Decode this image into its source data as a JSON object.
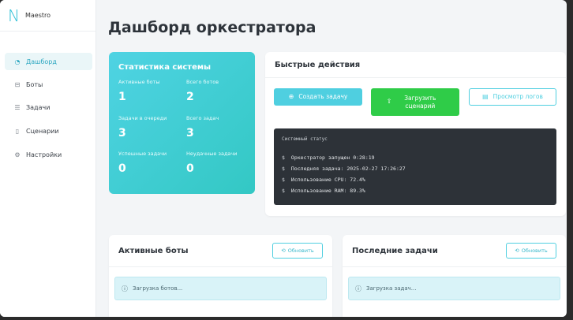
{
  "brand": {
    "logo": "N",
    "name": "Maestro"
  },
  "sidebar": {
    "items": [
      {
        "label": "Дашборд",
        "icon": "dashboard-icon",
        "glyph": "◔",
        "active": true
      },
      {
        "label": "Боты",
        "icon": "robot-icon",
        "glyph": "⊟"
      },
      {
        "label": "Задачи",
        "icon": "list-icon",
        "glyph": "☰"
      },
      {
        "label": "Сценарии",
        "icon": "file-icon",
        "glyph": "▯"
      },
      {
        "label": "Настройки",
        "icon": "gear-icon",
        "glyph": "⚙"
      }
    ]
  },
  "page": {
    "title": "Дашборд оркестратора"
  },
  "stats": {
    "title": "Статистика системы",
    "active_bots": {
      "label": "Активные боты",
      "value": "1"
    },
    "total_bots": {
      "label": "Всего ботов",
      "value": "2"
    },
    "queued_tasks": {
      "label": "Задачи в очереди",
      "value": "3"
    },
    "total_tasks": {
      "label": "Всего задач",
      "value": "3"
    },
    "success_tasks": {
      "label": "Успешные задачи",
      "value": "0"
    },
    "failed_tasks": {
      "label": "Неудачные задачи",
      "value": "0"
    }
  },
  "quick": {
    "title": "Быстрые действия",
    "create_label": "Создать задачу",
    "upload_label": "Загрузить сценарий",
    "logs_label": "Просмотр логов"
  },
  "terminal": {
    "title": "Системный статус",
    "prompt": "$",
    "lines": [
      "Оркестратор запущен 0:28:19",
      "Последняя задача: 2025-02-27 17:26:27",
      "Использование CPU: 72.4%",
      "Использование RAM: 89.3%"
    ]
  },
  "bots_panel": {
    "title": "Активные боты",
    "refresh_label": "Обновить",
    "loading": "Загрузка ботов..."
  },
  "tasks_panel": {
    "title": "Последние задачи",
    "refresh_label": "Обновить",
    "loading": "Загрузка задач..."
  },
  "colors": {
    "accent": "#4fcfe0",
    "success": "#2fcc48",
    "terminal_bg": "#2d3238"
  }
}
